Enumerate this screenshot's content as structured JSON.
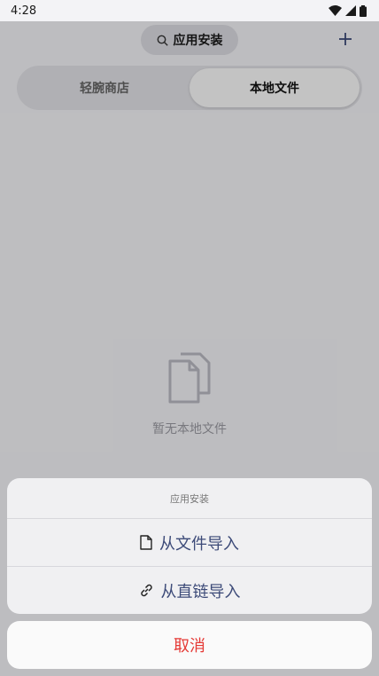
{
  "status_bar": {
    "time": "4:28"
  },
  "header": {
    "title": "应用安装",
    "icons": [
      "search-icon",
      "add-icon"
    ]
  },
  "tabs": [
    {
      "label": "轻腕商店",
      "active": false
    },
    {
      "label": "本地文件",
      "active": true
    }
  ],
  "empty_state": {
    "icon": "files-icon",
    "text": "暂无本地文件"
  },
  "action_sheet": {
    "title": "应用安装",
    "options": [
      {
        "label": "从文件导入",
        "icon": "file-icon"
      },
      {
        "label": "从直链导入",
        "icon": "link-icon"
      }
    ],
    "cancel_label": "取消"
  },
  "colors": {
    "accent_text": "#3c4a78",
    "cancel": "#e53935",
    "overlay": "rgba(0,0,0,0.22)"
  }
}
